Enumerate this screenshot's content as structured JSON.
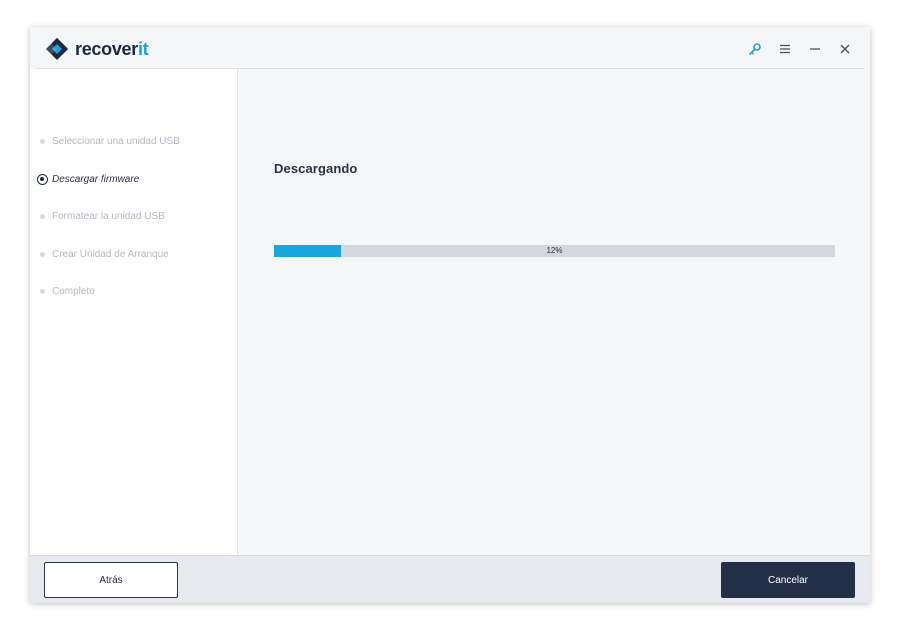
{
  "app": {
    "logo_text": "recover",
    "logo_accent": "it",
    "accent_color": "#1aa1d9"
  },
  "titlebar": {
    "icons": [
      "key-icon",
      "menu-icon",
      "minimize-icon",
      "close-icon"
    ]
  },
  "steps": [
    {
      "label": "Seleccionar una unidad USB",
      "state": "pending"
    },
    {
      "label": "Descargar firmware",
      "state": "active"
    },
    {
      "label": "Formatear la unidad USB",
      "state": "pending"
    },
    {
      "label": "Crear Unidad de Arranque",
      "state": "pending"
    },
    {
      "label": "Completo",
      "state": "pending"
    }
  ],
  "main": {
    "title": "Descargando",
    "progress": {
      "value": 12,
      "label": "12%",
      "color": "#19a6dc"
    }
  },
  "footer": {
    "back_label": "Atrás",
    "cancel_label": "Cancelar"
  }
}
